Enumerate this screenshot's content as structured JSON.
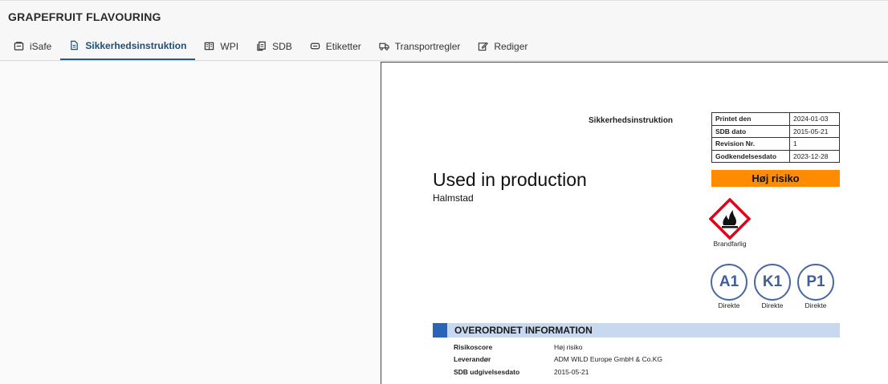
{
  "app": {
    "title": "GRAPEFRUIT FLAVOURING"
  },
  "tabs": [
    {
      "label": "iSafe",
      "icon": "safe-icon",
      "active": false
    },
    {
      "label": "Sikkerhedsinstruktion",
      "icon": "document-icon",
      "active": true
    },
    {
      "label": "WPI",
      "icon": "book-icon",
      "active": false
    },
    {
      "label": "SDB",
      "icon": "copy-icon",
      "active": false
    },
    {
      "label": "Etiketter",
      "icon": "label-icon",
      "active": false
    },
    {
      "label": "Transportregler",
      "icon": "truck-icon",
      "active": false
    },
    {
      "label": "Rediger",
      "icon": "edit-icon",
      "active": false
    }
  ],
  "document": {
    "doc_title": "Sikkerhedsinstruktion",
    "meta": [
      {
        "key": "Printet den",
        "value": "2024-01-03"
      },
      {
        "key": "SDB dato",
        "value": "2015-05-21"
      },
      {
        "key": "Revision Nr.",
        "value": "1"
      },
      {
        "key": "Godkendelsesdato",
        "value": "2023-12-28"
      }
    ],
    "risk_label": "Høj risiko",
    "risk_color": "#ff8c00",
    "heading": "Used in production",
    "subheading": "Halmstad",
    "ghs": {
      "icon": "flammable-icon",
      "label": "Brandfarlig",
      "border_color": "#e2001a"
    },
    "ppe": [
      {
        "code": "A1",
        "label": "Direkte"
      },
      {
        "code": "K1",
        "label": "Direkte"
      },
      {
        "code": "P1",
        "label": "Direkte"
      }
    ],
    "section_title": "OVERORDNET INFORMATION",
    "info": [
      {
        "key": "Risikoscore",
        "value": "Høj risiko"
      },
      {
        "key": "Leverandør",
        "value": "ADM WILD Europe GmbH & Co.KG"
      },
      {
        "key": "SDB udgivelsesdato",
        "value": "2015-05-21"
      }
    ]
  }
}
